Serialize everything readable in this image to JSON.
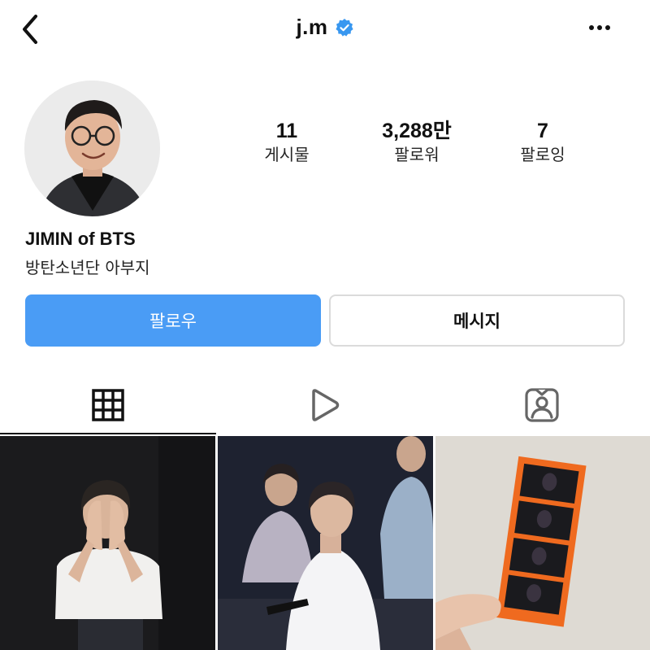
{
  "header": {
    "username": "j.m",
    "verified": true,
    "verified_color": "#3897f0",
    "back_icon": "chevron-left-icon",
    "more_icon": "ellipsis-icon"
  },
  "profile": {
    "display_name": "JIMIN of BTS",
    "bio": "방탄소년단 아부지",
    "stats": [
      {
        "value": "11",
        "label": "게시물"
      },
      {
        "value": "3,288만",
        "label": "팔로워"
      },
      {
        "value": "7",
        "label": "팔로잉"
      }
    ]
  },
  "actions": {
    "follow_label": "팔로우",
    "message_label": "메시지",
    "follow_color": "#4a9cf5"
  },
  "tabs": [
    {
      "icon": "grid-icon",
      "active": true
    },
    {
      "icon": "reels-icon",
      "active": false
    },
    {
      "icon": "tagged-icon",
      "active": false
    }
  ],
  "posts": [
    {
      "description": "photo of a person in white t-shirt covering face with hands"
    },
    {
      "description": "group photo of performers in white outfits"
    },
    {
      "description": "hand holding an orange photo strip against a white wall"
    }
  ]
}
